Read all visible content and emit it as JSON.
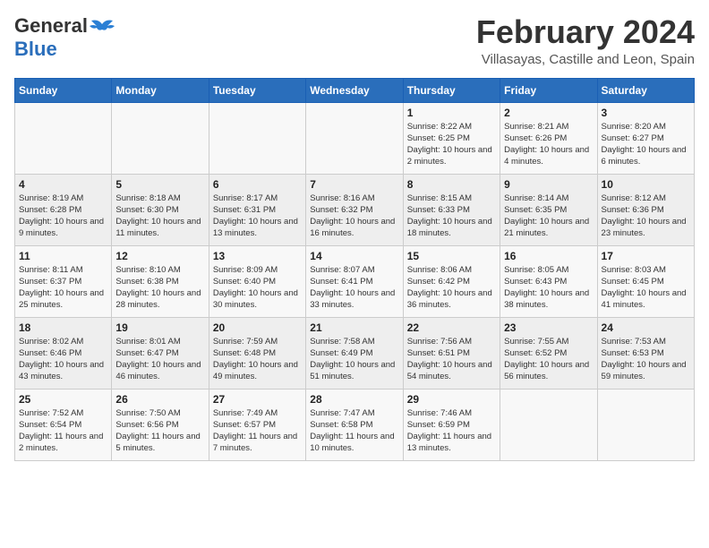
{
  "header": {
    "logo_general": "General",
    "logo_blue": "Blue",
    "month_title": "February 2024",
    "location": "Villasayas, Castille and Leon, Spain"
  },
  "calendar": {
    "days_of_week": [
      "Sunday",
      "Monday",
      "Tuesday",
      "Wednesday",
      "Thursday",
      "Friday",
      "Saturday"
    ],
    "weeks": [
      [
        {
          "day": "",
          "info": ""
        },
        {
          "day": "",
          "info": ""
        },
        {
          "day": "",
          "info": ""
        },
        {
          "day": "",
          "info": ""
        },
        {
          "day": "1",
          "info": "Sunrise: 8:22 AM\nSunset: 6:25 PM\nDaylight: 10 hours and 2 minutes."
        },
        {
          "day": "2",
          "info": "Sunrise: 8:21 AM\nSunset: 6:26 PM\nDaylight: 10 hours and 4 minutes."
        },
        {
          "day": "3",
          "info": "Sunrise: 8:20 AM\nSunset: 6:27 PM\nDaylight: 10 hours and 6 minutes."
        }
      ],
      [
        {
          "day": "4",
          "info": "Sunrise: 8:19 AM\nSunset: 6:28 PM\nDaylight: 10 hours and 9 minutes."
        },
        {
          "day": "5",
          "info": "Sunrise: 8:18 AM\nSunset: 6:30 PM\nDaylight: 10 hours and 11 minutes."
        },
        {
          "day": "6",
          "info": "Sunrise: 8:17 AM\nSunset: 6:31 PM\nDaylight: 10 hours and 13 minutes."
        },
        {
          "day": "7",
          "info": "Sunrise: 8:16 AM\nSunset: 6:32 PM\nDaylight: 10 hours and 16 minutes."
        },
        {
          "day": "8",
          "info": "Sunrise: 8:15 AM\nSunset: 6:33 PM\nDaylight: 10 hours and 18 minutes."
        },
        {
          "day": "9",
          "info": "Sunrise: 8:14 AM\nSunset: 6:35 PM\nDaylight: 10 hours and 21 minutes."
        },
        {
          "day": "10",
          "info": "Sunrise: 8:12 AM\nSunset: 6:36 PM\nDaylight: 10 hours and 23 minutes."
        }
      ],
      [
        {
          "day": "11",
          "info": "Sunrise: 8:11 AM\nSunset: 6:37 PM\nDaylight: 10 hours and 25 minutes."
        },
        {
          "day": "12",
          "info": "Sunrise: 8:10 AM\nSunset: 6:38 PM\nDaylight: 10 hours and 28 minutes."
        },
        {
          "day": "13",
          "info": "Sunrise: 8:09 AM\nSunset: 6:40 PM\nDaylight: 10 hours and 30 minutes."
        },
        {
          "day": "14",
          "info": "Sunrise: 8:07 AM\nSunset: 6:41 PM\nDaylight: 10 hours and 33 minutes."
        },
        {
          "day": "15",
          "info": "Sunrise: 8:06 AM\nSunset: 6:42 PM\nDaylight: 10 hours and 36 minutes."
        },
        {
          "day": "16",
          "info": "Sunrise: 8:05 AM\nSunset: 6:43 PM\nDaylight: 10 hours and 38 minutes."
        },
        {
          "day": "17",
          "info": "Sunrise: 8:03 AM\nSunset: 6:45 PM\nDaylight: 10 hours and 41 minutes."
        }
      ],
      [
        {
          "day": "18",
          "info": "Sunrise: 8:02 AM\nSunset: 6:46 PM\nDaylight: 10 hours and 43 minutes."
        },
        {
          "day": "19",
          "info": "Sunrise: 8:01 AM\nSunset: 6:47 PM\nDaylight: 10 hours and 46 minutes."
        },
        {
          "day": "20",
          "info": "Sunrise: 7:59 AM\nSunset: 6:48 PM\nDaylight: 10 hours and 49 minutes."
        },
        {
          "day": "21",
          "info": "Sunrise: 7:58 AM\nSunset: 6:49 PM\nDaylight: 10 hours and 51 minutes."
        },
        {
          "day": "22",
          "info": "Sunrise: 7:56 AM\nSunset: 6:51 PM\nDaylight: 10 hours and 54 minutes."
        },
        {
          "day": "23",
          "info": "Sunrise: 7:55 AM\nSunset: 6:52 PM\nDaylight: 10 hours and 56 minutes."
        },
        {
          "day": "24",
          "info": "Sunrise: 7:53 AM\nSunset: 6:53 PM\nDaylight: 10 hours and 59 minutes."
        }
      ],
      [
        {
          "day": "25",
          "info": "Sunrise: 7:52 AM\nSunset: 6:54 PM\nDaylight: 11 hours and 2 minutes."
        },
        {
          "day": "26",
          "info": "Sunrise: 7:50 AM\nSunset: 6:56 PM\nDaylight: 11 hours and 5 minutes."
        },
        {
          "day": "27",
          "info": "Sunrise: 7:49 AM\nSunset: 6:57 PM\nDaylight: 11 hours and 7 minutes."
        },
        {
          "day": "28",
          "info": "Sunrise: 7:47 AM\nSunset: 6:58 PM\nDaylight: 11 hours and 10 minutes."
        },
        {
          "day": "29",
          "info": "Sunrise: 7:46 AM\nSunset: 6:59 PM\nDaylight: 11 hours and 13 minutes."
        },
        {
          "day": "",
          "info": ""
        },
        {
          "day": "",
          "info": ""
        }
      ]
    ]
  }
}
